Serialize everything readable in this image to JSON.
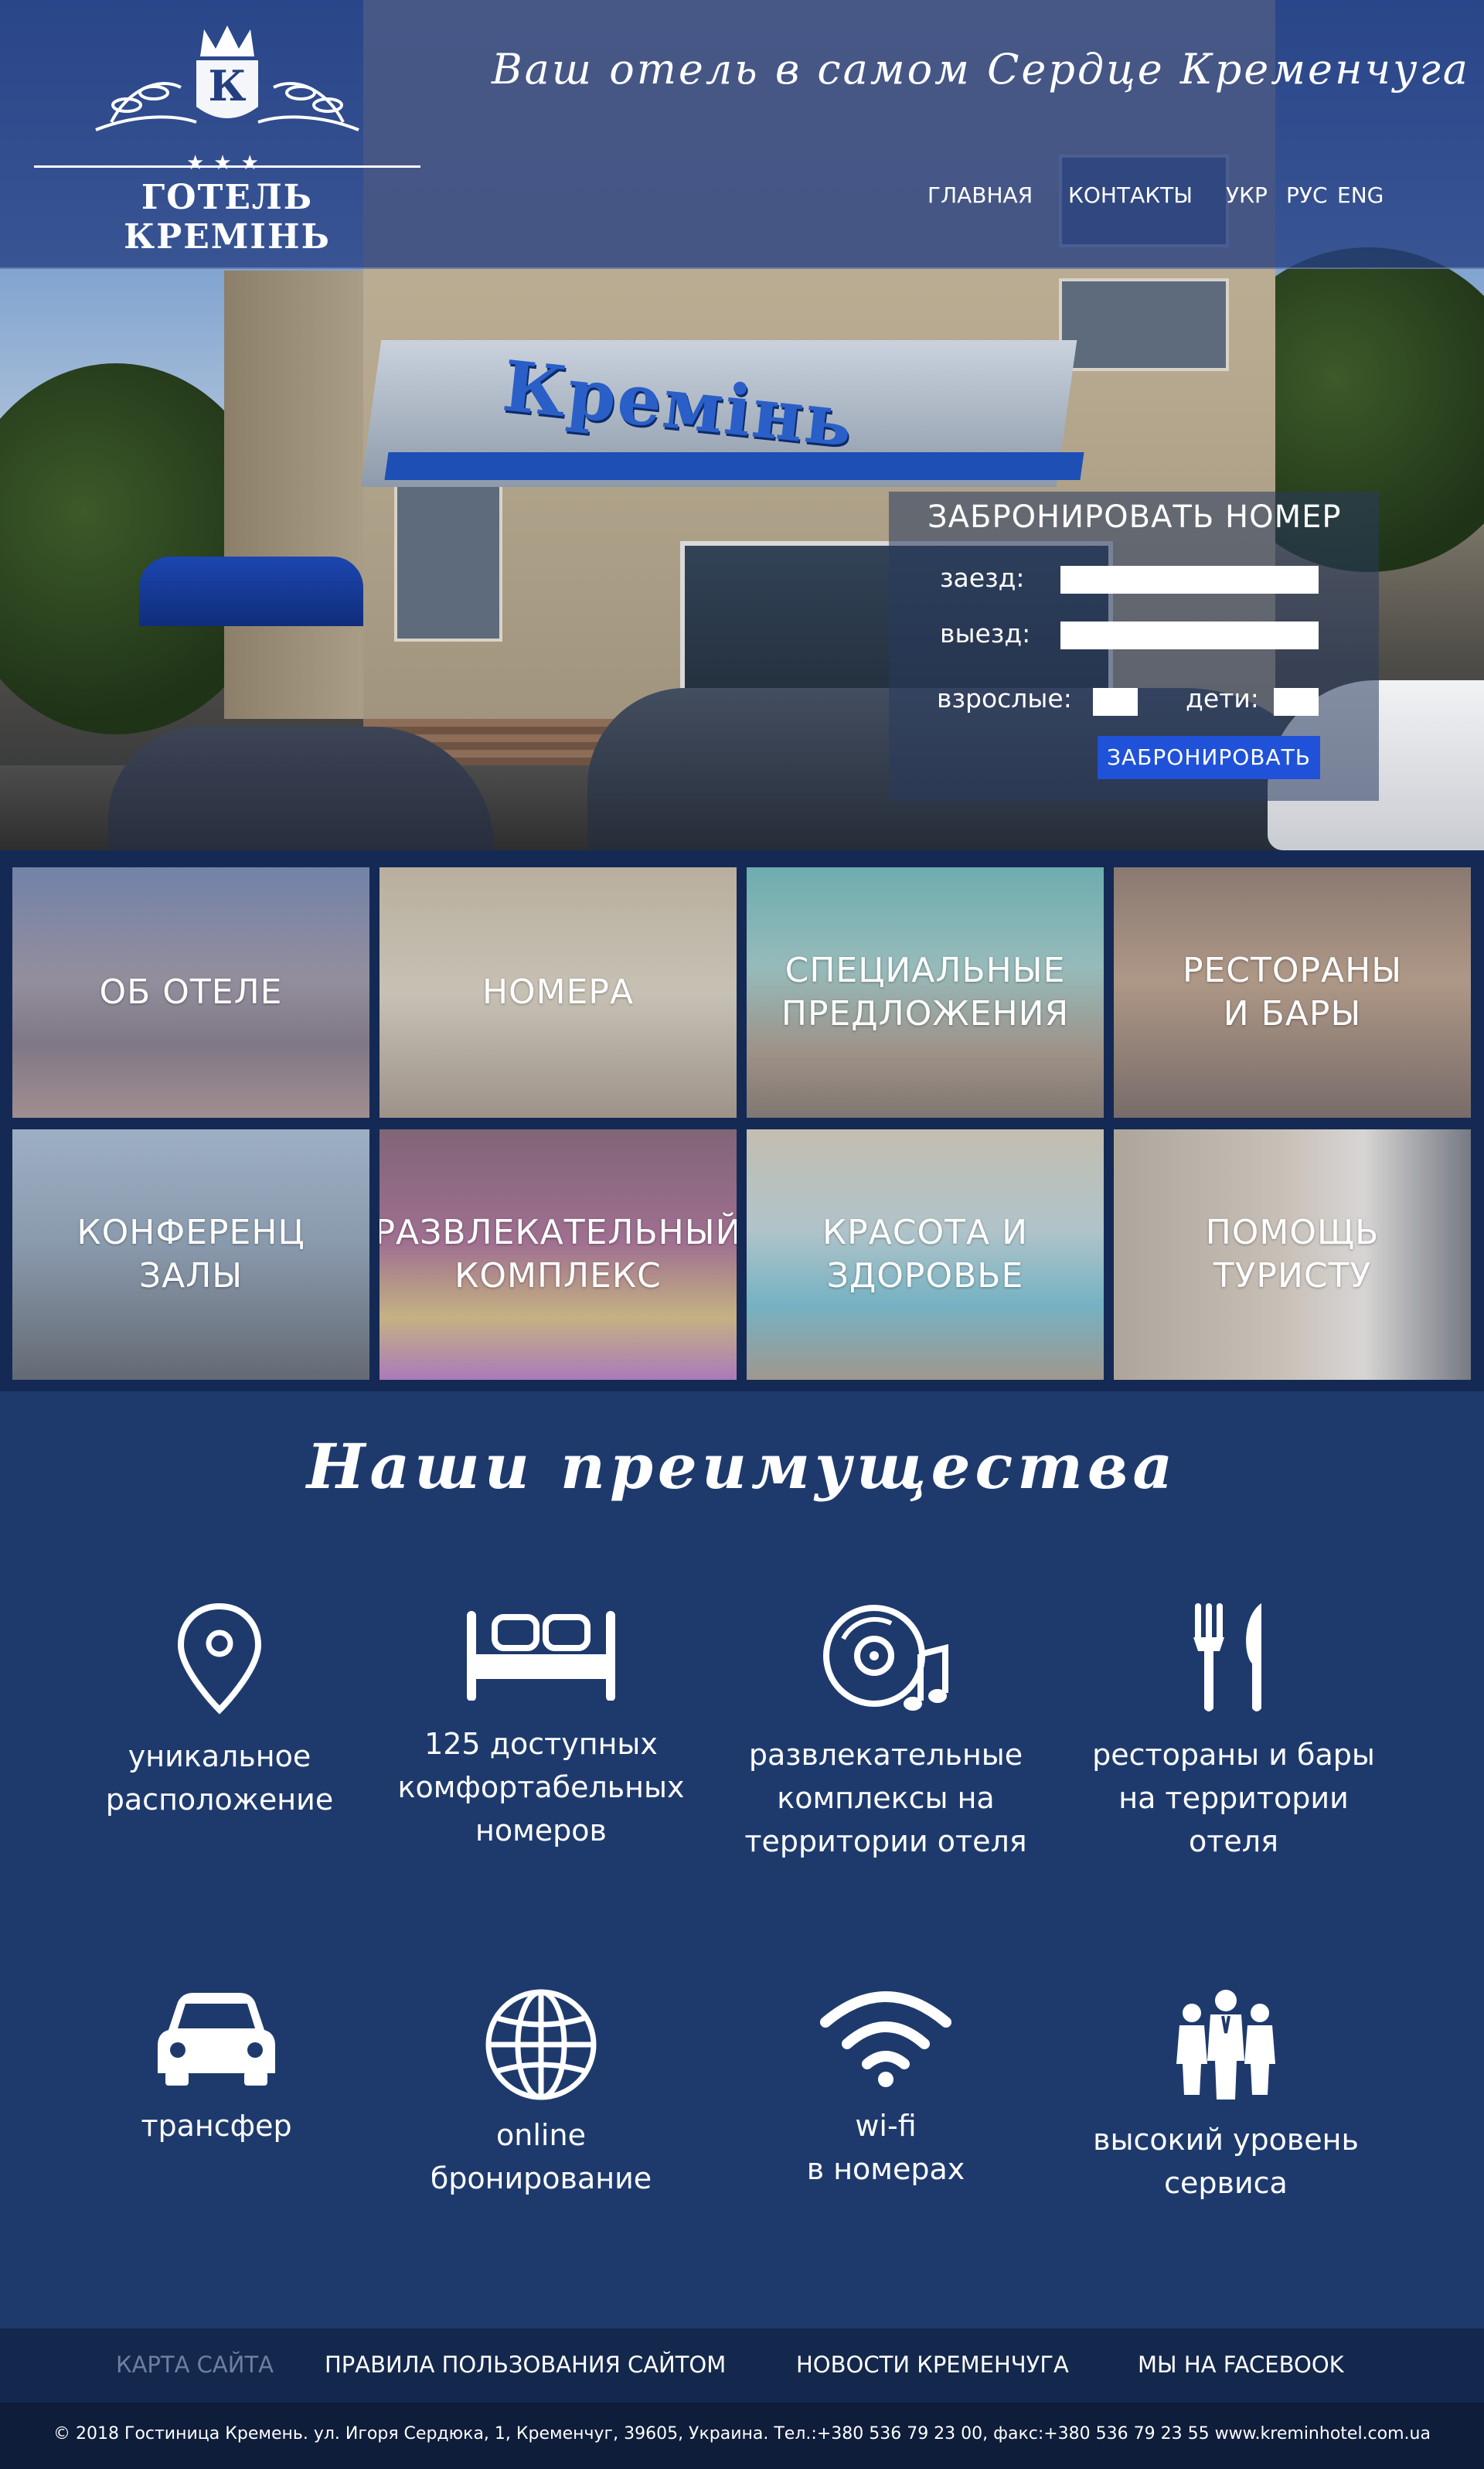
{
  "header": {
    "logo_stars": "★★★",
    "logo_name": "ГОТЕЛЬ КРЕМІНЬ",
    "tagline": "Ваш отель в самом Сердце Кременчуга",
    "nav": [
      {
        "label": "ГЛАВНАЯ"
      },
      {
        "label": "КОНТАКТЫ"
      },
      {
        "label": "УКР"
      },
      {
        "label": "РУС"
      },
      {
        "label": "ENG"
      }
    ]
  },
  "hero": {
    "sign_text": "Кремінь"
  },
  "booking": {
    "title": "ЗАБРОНИРОВАТЬ НОМЕР",
    "checkin_label": "заезд:",
    "checkout_label": "выезд:",
    "adults_label": "взрослые:",
    "children_label": "дети:",
    "checkin_value": "",
    "checkout_value": "",
    "adults_value": "",
    "children_value": "",
    "submit_label": "ЗАБРОНИРОВАТЬ"
  },
  "tiles": [
    {
      "label": "ОБ ОТЕЛЕ"
    },
    {
      "label": "НОМЕРА"
    },
    {
      "label": "СПЕЦИАЛЬНЫЕ\nПРЕДЛОЖЕНИЯ"
    },
    {
      "label": "РЕСТОРАНЫ\nИ  БАРЫ"
    },
    {
      "label": "КОНФЕРЕНЦ\nЗАЛЫ"
    },
    {
      "label": "РАЗВЛЕКАТЕЛЬНЫЙ\nКОМПЛЕКС"
    },
    {
      "label": "КРАСОТА И\nЗДОРОВЬЕ"
    },
    {
      "label": "ПОМОЩЬ\nТУРИСТУ"
    }
  ],
  "advantages": {
    "title": "Наши преимущества",
    "items": [
      {
        "icon": "location-pin-icon",
        "text": "уникальное\nрасположение"
      },
      {
        "icon": "bed-icon",
        "text": "125 доступных\nкомфортабельных\nномеров"
      },
      {
        "icon": "music-disc-icon",
        "text": "развлекательные\nкомплексы на\nтерритории отеля"
      },
      {
        "icon": "fork-knife-icon",
        "text": "рестораны и бары\nна территории\nотеля"
      },
      {
        "icon": "car-icon",
        "text": "трансфер"
      },
      {
        "icon": "globe-icon",
        "text": "online\nбронирование"
      },
      {
        "icon": "wifi-icon",
        "text": "wi-fi\nв номерах"
      },
      {
        "icon": "staff-icon",
        "text": "высокий уровень\nсервиса"
      }
    ]
  },
  "footer": {
    "links": [
      {
        "label": "КАРТА САЙТА"
      },
      {
        "label": "ПРАВИЛА ПОЛЬЗОВАНИЯ САЙТОМ"
      },
      {
        "label": "НОВОСТИ КРЕМЕНЧУГА"
      },
      {
        "label": "МЫ НА FACEBOOK"
      }
    ],
    "copyright": "© 2018 Гостиница Кремень. ул. Игоря Сердюка, 1, Кременчуг, 39605, Украина. Тел.:+380 536 79 23 00, факс:+380 536 79 23 55   www.kreminhotel.com.ua"
  },
  "colors": {
    "header_band": "#243e82",
    "advantages_bg": "#1e3a6d",
    "footer_links_bg": "#14284d",
    "footer_copy_bg": "#0e1d3a",
    "book_button": "#1f52d8"
  }
}
